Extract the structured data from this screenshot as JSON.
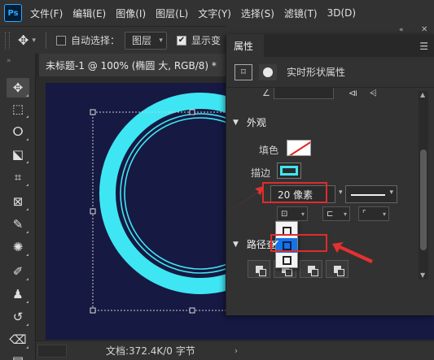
{
  "app": {
    "logo_text": "Ps"
  },
  "menubar": {
    "items": [
      "文件(F)",
      "编辑(E)",
      "图像(I)",
      "图层(L)",
      "文字(Y)",
      "选择(S)",
      "滤镜(T)",
      "3D(D)"
    ]
  },
  "options": {
    "auto_select_label": "自动选择：",
    "auto_select_checked": false,
    "auto_select_value": "图层",
    "show_transform_label": "显示变",
    "show_transform_checked": true
  },
  "document": {
    "tab_title": "未标题-1 @ 100% (椭圆 大, RGB/8) *",
    "status_text": "文档:372.4K/0 字节",
    "canvas_color": "#161942",
    "ring_color": "#3ee6f3"
  },
  "tools": [
    {
      "name": "move-tool",
      "glyph": "✥"
    },
    {
      "name": "marquee-tool",
      "glyph": "⬚"
    },
    {
      "name": "lasso-tool",
      "glyph": "ⵔ"
    },
    {
      "name": "object-select-tool",
      "glyph": "⬕"
    },
    {
      "name": "crop-tool",
      "glyph": "⌗"
    },
    {
      "name": "frame-tool",
      "glyph": "⊠"
    },
    {
      "name": "eyedropper-tool",
      "glyph": "✎"
    },
    {
      "name": "spot-heal-tool",
      "glyph": "✺"
    },
    {
      "name": "brush-tool",
      "glyph": "✐"
    },
    {
      "name": "stamp-tool",
      "glyph": "♟"
    },
    {
      "name": "history-brush-tool",
      "glyph": "↺"
    },
    {
      "name": "eraser-tool",
      "glyph": "⌫"
    },
    {
      "name": "gradient-tool",
      "glyph": "▤"
    }
  ],
  "properties_panel": {
    "tab_label": "属性",
    "shape_title": "实时形状属性",
    "appearance_label": "外观",
    "fill_label": "填色",
    "stroke_label": "描边",
    "stroke_width": "20 像素",
    "stroke_color": "#3ee6f3",
    "path_ops_label": "路径查"
  }
}
